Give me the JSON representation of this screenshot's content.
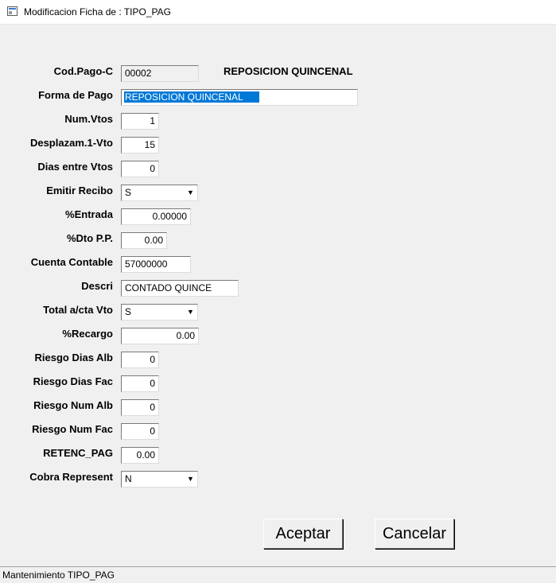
{
  "window": {
    "title": "Modificacion Ficha de : TIPO_PAG"
  },
  "form": {
    "cod_pago": {
      "label": "Cod.Pago-C",
      "value": "00002"
    },
    "cod_pago_desc": "REPOSICION QUINCENAL",
    "forma_pago": {
      "label": "Forma de Pago",
      "value": "REPOSICION QUINCENAL"
    },
    "num_vtos": {
      "label": "Num.Vtos",
      "value": "1"
    },
    "desplazam": {
      "label": "Desplazam.1-Vto",
      "value": "15"
    },
    "dias_entre": {
      "label": "Dias entre Vtos",
      "value": "0"
    },
    "emitir_recibo": {
      "label": "Emitir Recibo",
      "value": "S"
    },
    "entrada": {
      "label": "%Entrada",
      "value": "0.00000"
    },
    "dto_pp": {
      "label": "%Dto P.P.",
      "value": "0.00"
    },
    "cuenta": {
      "label": "Cuenta Contable",
      "value": "57000000"
    },
    "descri": {
      "label": "Descri",
      "value": "CONTADO QUINCE"
    },
    "total_cta": {
      "label": "Total a/cta Vto",
      "value": "S"
    },
    "recargo": {
      "label": "%Recargo",
      "value": "0.00"
    },
    "riesgo_dias_alb": {
      "label": "Riesgo Dias Alb",
      "value": "0"
    },
    "riesgo_dias_fac": {
      "label": "Riesgo Dias Fac",
      "value": "0"
    },
    "riesgo_num_alb": {
      "label": "Riesgo Num Alb",
      "value": "0"
    },
    "riesgo_num_fac": {
      "label": "Riesgo Num Fac",
      "value": "0"
    },
    "retenc": {
      "label": "RETENC_PAG",
      "value": "0.00"
    },
    "cobra_represent": {
      "label": "Cobra Represent",
      "value": "N"
    }
  },
  "buttons": {
    "accept": "Aceptar",
    "cancel": "Cancelar"
  },
  "status": "Mantenimiento TIPO_PAG",
  "icons": {
    "combo_arrow": "chevron-down-icon",
    "app": "window-icon"
  }
}
